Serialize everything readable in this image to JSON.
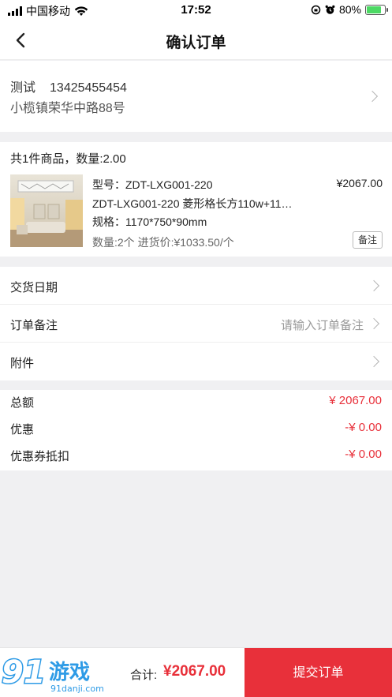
{
  "status_bar": {
    "carrier": "中国移动",
    "time": "17:52",
    "battery": "80%",
    "battery_level": 0.8
  },
  "nav": {
    "title": "确认订单",
    "back_icon": "chevron-left-icon"
  },
  "address": {
    "name": "测试",
    "phone": "13425455454",
    "detail": "小榄镇荣华中路88号"
  },
  "goods": {
    "summary": "共1件商品，数量:2.00",
    "items": [
      {
        "model": "型号：ZDT-LXG001-220",
        "price": "¥2067.00",
        "name": "ZDT-LXG001-220 菱形格长方110w+11…",
        "spec": "规格：1170*750*90mm",
        "qty_price": "数量:2个 进货价:¥1033.50/个",
        "remark_button": "备注"
      }
    ]
  },
  "rows": {
    "delivery_date": "交货日期",
    "order_note": "订单备注",
    "order_note_placeholder": "请输入订单备注",
    "attachment": "附件"
  },
  "totals": {
    "total_label": "总额",
    "total_value": "¥ 2067.00",
    "discount_label": "优惠",
    "discount_value": "-¥ 0.00",
    "coupon_label": "优惠券抵扣",
    "coupon_value": "-¥ 0.00"
  },
  "bottom_bar": {
    "watermark_logo": "91游戏",
    "watermark_url": "91danji.com",
    "sum_label": "合计:",
    "sum_value": "¥2067.00",
    "submit_label": "提交订单"
  },
  "colors": {
    "accent": "#e8303a",
    "background": "#f0f0f2"
  }
}
